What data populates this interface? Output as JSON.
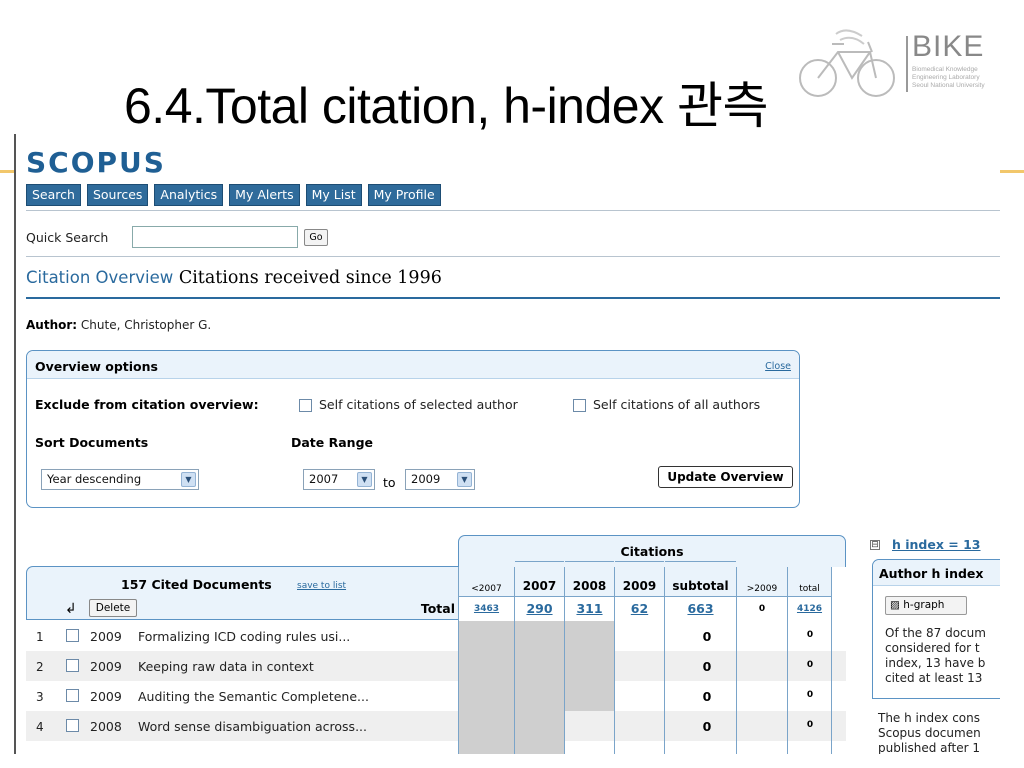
{
  "slide": {
    "title": "6.4.Total citation, h-index 관측"
  },
  "logo": {
    "word": "BIKE",
    "sub_lines": [
      "Biomedical Knowledge",
      "Engineering Laboratory",
      "Seoul National University"
    ]
  },
  "scopus": {
    "logo_text": "SCOPUS",
    "nav": [
      "Search",
      "Sources",
      "Analytics",
      "My Alerts",
      "My List",
      "My Profile"
    ],
    "quick_search": {
      "label": "Quick Search",
      "value": "",
      "go": "Go"
    },
    "heading": {
      "link": "Citation Overview",
      "rest": "Citations received since 1996"
    },
    "author": {
      "label": "Author:",
      "name": "Chute, Christopher G."
    },
    "options": {
      "title": "Overview options",
      "close": "Close",
      "exclude_label": "Exclude from citation overview:",
      "self_selected": "Self citations of selected author",
      "self_all": "Self citations of all authors",
      "sort_label": "Sort Documents",
      "sort_value": "Year descending",
      "date_label": "Date Range",
      "date_from": "2007",
      "to": "to",
      "date_to": "2009",
      "update": "Update Overview"
    },
    "table": {
      "docs_title": "157 Cited Documents",
      "save_link": "save to list",
      "delete": "Delete",
      "total_label": "Total",
      "citations_title": "Citations",
      "columns": [
        "<2007",
        "2007",
        "2008",
        "2009",
        "subtotal",
        ">2009",
        "total"
      ],
      "totals": [
        "3463",
        "290",
        "311",
        "62",
        "663",
        "0",
        "4126"
      ],
      "rows": [
        {
          "num": "1",
          "year": "2009",
          "title": "Formalizing ICD coding rules usi...",
          "subtotal": "0",
          "total": "0"
        },
        {
          "num": "2",
          "year": "2009",
          "title": "Keeping raw data in context",
          "subtotal": "0",
          "total": "0"
        },
        {
          "num": "3",
          "year": "2009",
          "title": "Auditing the Semantic Completene...",
          "subtotal": "0",
          "total": "0"
        },
        {
          "num": "4",
          "year": "2008",
          "title": "Word sense disambiguation across...",
          "subtotal": "0",
          "total": "0"
        }
      ]
    },
    "hindex": {
      "toggle": "⊟",
      "link": "h index = 13",
      "box_title": "Author h index",
      "graph_button": "h-graph",
      "text1": "Of the 87 docum\nconsidered for t\nindex, 13 have b\ncited at least 13",
      "text2": "The h index cons\nScopus documen\npublished after 1"
    }
  }
}
